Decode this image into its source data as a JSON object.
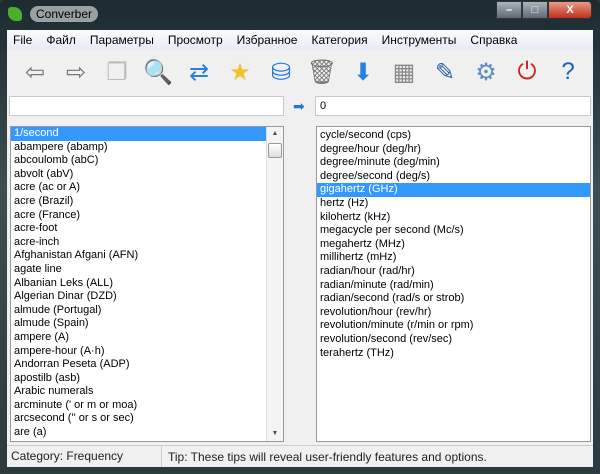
{
  "window": {
    "title": "Converber",
    "minimize": "–",
    "maximize": "□",
    "close": "X"
  },
  "menu": [
    "File",
    "Файл",
    "Параметры",
    "Просмотр",
    "Избранное",
    "Категория",
    "Инструменты",
    "Справка"
  ],
  "toolbar": [
    {
      "name": "back-icon",
      "glyph": "⇦",
      "color": "#777"
    },
    {
      "name": "forward-icon",
      "glyph": "⇨",
      "color": "#777"
    },
    {
      "name": "copy-icon",
      "glyph": "❐",
      "color": "#bbb"
    },
    {
      "name": "search-icon",
      "glyph": "🔍",
      "color": "#e0a020"
    },
    {
      "name": "swap-icon",
      "glyph": "⇄",
      "color": "#2a80e0"
    },
    {
      "name": "add-favorite-icon",
      "glyph": "★",
      "color": "#f2c12e"
    },
    {
      "name": "database-icon",
      "glyph": "⛁",
      "color": "#1f78d8"
    },
    {
      "name": "trash-icon",
      "glyph": "🗑",
      "color": "#777"
    },
    {
      "name": "download-arrow-icon",
      "glyph": "⬇",
      "color": "#2a80e0"
    },
    {
      "name": "calculator-icon",
      "glyph": "▦",
      "color": "#888"
    },
    {
      "name": "edit-icon",
      "glyph": "✎",
      "color": "#2a5fb0"
    },
    {
      "name": "settings-icon",
      "glyph": "⚙",
      "color": "#5a8fc8"
    },
    {
      "name": "power-icon",
      "glyph": "⏻",
      "color": "#d02020"
    },
    {
      "name": "help-icon",
      "glyph": "?",
      "color": "#1a5fc8"
    }
  ],
  "input": {
    "from_value": "",
    "to_value": "0"
  },
  "from_units": [
    "1/second",
    "abampere (abamp)",
    "abcoulomb (abC)",
    "abvolt (abV)",
    "acre (ac or A)",
    "acre (Brazil)",
    "acre (France)",
    "acre-foot",
    "acre-inch",
    "Afghanistan Afgani (AFN)",
    "agate line",
    "Albanian Leks (ALL)",
    "Algerian Dinar (DZD)",
    "almude (Portugal)",
    "almude (Spain)",
    "ampere (A)",
    "ampere-hour (A·h)",
    "Andorran Peseta (ADP)",
    "apostilb (asb)",
    "Arabic numerals",
    "arcminute (' or m or moa)",
    "arcsecond ('' or s or sec)",
    "are (a)"
  ],
  "to_units": [
    "cycle/second (cps)",
    "degree/hour (deg/hr)",
    "degree/minute (deg/min)",
    "degree/second (deg/s)",
    "gigahertz (GHz)",
    "hertz (Hz)",
    "kilohertz (kHz)",
    "megacycle per second (Mc/s)",
    "megahertz (MHz)",
    "millihertz (mHz)",
    "radian/hour (rad/hr)",
    "radian/minute (rad/min)",
    "radian/second (rad/s or strob)",
    "revolution/hour (rev/hr)",
    "revolution/minute (r/min or rpm)",
    "revolution/second (rev/sec)",
    "terahertz (THz)"
  ],
  "from_selected": 0,
  "to_selected": 4,
  "status": {
    "category": "Category: Frequency",
    "tip": "Tip: These tips will reveal user-friendly features and options."
  }
}
